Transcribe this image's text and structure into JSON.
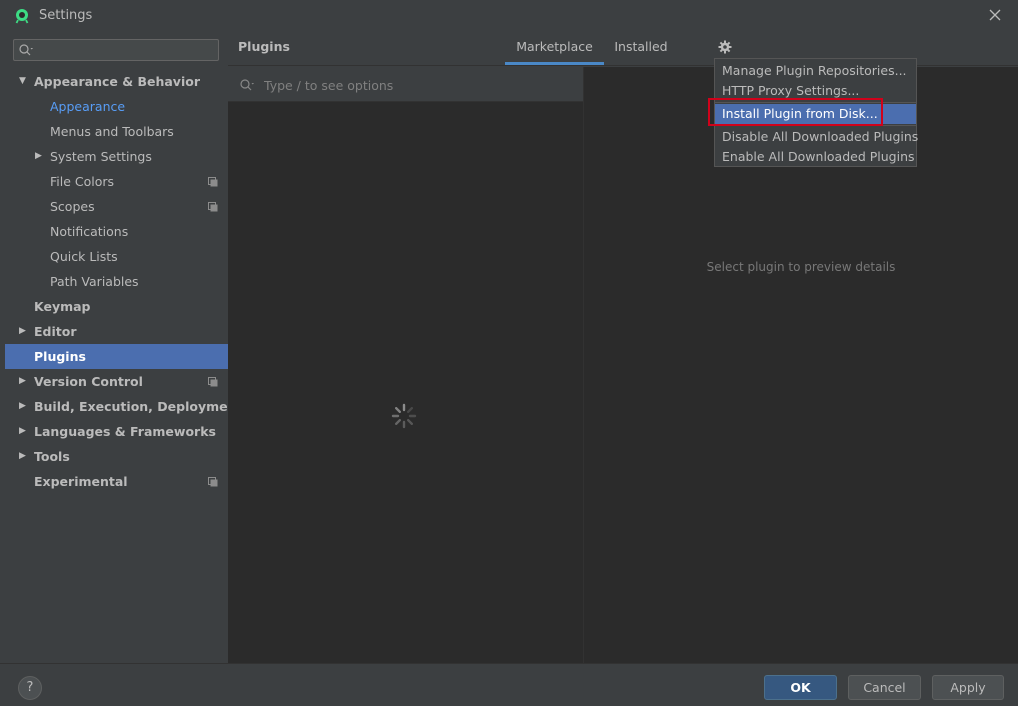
{
  "window": {
    "title": "Settings",
    "close_icon": "close-icon",
    "app_icon": "android-studio-icon"
  },
  "sidebar": {
    "search_placeholder": "",
    "items": [
      {
        "label": "Appearance & Behavior",
        "level": 0,
        "expanded": true,
        "bold": true
      },
      {
        "label": "Appearance",
        "level": 1,
        "highlight": true
      },
      {
        "label": "Menus and Toolbars",
        "level": 1
      },
      {
        "label": "System Settings",
        "level": 1,
        "collapsed": true
      },
      {
        "label": "File Colors",
        "level": 1,
        "project_icon": true
      },
      {
        "label": "Scopes",
        "level": 1,
        "project_icon": true
      },
      {
        "label": "Notifications",
        "level": 1
      },
      {
        "label": "Quick Lists",
        "level": 1
      },
      {
        "label": "Path Variables",
        "level": 1
      },
      {
        "label": "Keymap",
        "level": 0,
        "bold": true
      },
      {
        "label": "Editor",
        "level": 0,
        "collapsed": true,
        "bold": true
      },
      {
        "label": "Plugins",
        "level": 0,
        "bold": true,
        "selected": true
      },
      {
        "label": "Version Control",
        "level": 0,
        "collapsed": true,
        "bold": true,
        "project_icon": true
      },
      {
        "label": "Build, Execution, Deployment",
        "level": 0,
        "collapsed": true,
        "bold": true
      },
      {
        "label": "Languages & Frameworks",
        "level": 0,
        "collapsed": true,
        "bold": true
      },
      {
        "label": "Tools",
        "level": 0,
        "collapsed": true,
        "bold": true
      },
      {
        "label": "Experimental",
        "level": 0,
        "bold": true,
        "project_icon": true
      }
    ]
  },
  "main": {
    "title": "Plugins",
    "tabs": [
      {
        "label": "Marketplace",
        "active": true
      },
      {
        "label": "Installed",
        "active": false
      }
    ],
    "gear_icon": "gear-icon",
    "search_placeholder": "Type / to see options",
    "preview_text": "Select plugin to preview details"
  },
  "menu": {
    "items": [
      {
        "label": "Manage Plugin Repositories..."
      },
      {
        "label": "HTTP Proxy Settings..."
      },
      {
        "label": "Install Plugin from Disk...",
        "selected": true
      },
      {
        "label": "Disable All Downloaded Plugins"
      },
      {
        "label": "Enable All Downloaded Plugins"
      }
    ]
  },
  "footer": {
    "help_label": "?",
    "ok_label": "OK",
    "cancel_label": "Cancel",
    "apply_label": "Apply"
  },
  "colors": {
    "background": "#3c3f41",
    "panel": "#2b2b2b",
    "selection": "#4b6eaf",
    "link": "#589df6",
    "tab_underline": "#4a88c7",
    "primary_button": "#365880",
    "highlight_border": "#d0021b"
  }
}
